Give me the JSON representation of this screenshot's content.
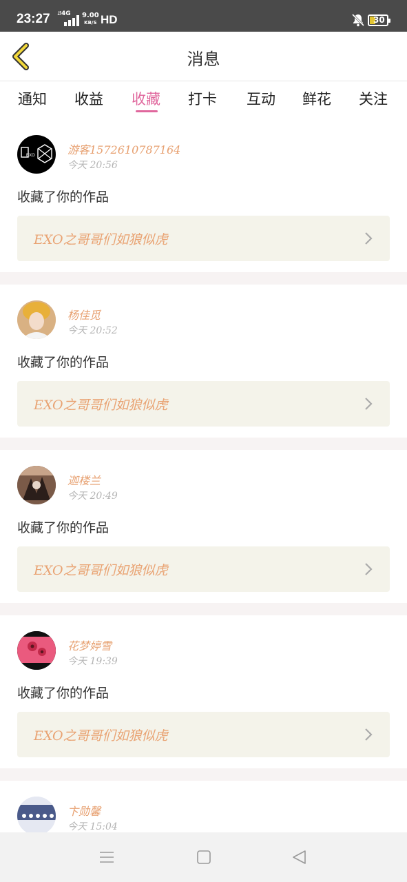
{
  "status_bar": {
    "time": "23:27",
    "network": "4G",
    "speed_value": "9.00",
    "speed_unit": "KB/S",
    "hd": "HD",
    "battery": "30",
    "icons": [
      "signal-icon",
      "bell-muted-icon",
      "battery-icon"
    ]
  },
  "header": {
    "title": "消息",
    "back_icon": "chevron-left-icon",
    "accent": "#f2d83a"
  },
  "tabs": [
    {
      "label": "通知",
      "active": false
    },
    {
      "label": "收益",
      "active": false
    },
    {
      "label": "收藏",
      "active": true
    },
    {
      "label": "打卡",
      "active": false
    },
    {
      "label": "互动",
      "active": false
    },
    {
      "label": "鲜花",
      "active": false
    },
    {
      "label": "关注",
      "active": false
    }
  ],
  "colors": {
    "active_tab": "#e0679d",
    "username": "#e7a070",
    "work_title": "#e9a373",
    "work_bg": "#f4f3ea"
  },
  "feed": [
    {
      "username": "游客1572610787164",
      "time": "今天 20:56",
      "action": "收藏了你的作品",
      "work_title": "EXO之哥哥们如狼似虎"
    },
    {
      "username": "杨佳觅",
      "time": "今天 20:52",
      "action": "收藏了你的作品",
      "work_title": "EXO之哥哥们如狼似虎"
    },
    {
      "username": "迦楼兰",
      "time": "今天 20:49",
      "action": "收藏了你的作品",
      "work_title": "EXO之哥哥们如狼似虎"
    },
    {
      "username": "花梦婷雪",
      "time": "今天 19:39",
      "action": "收藏了你的作品",
      "work_title": "EXO之哥哥们如狼似虎"
    },
    {
      "username": "卞勋馨",
      "time": "今天 15:04"
    }
  ],
  "nav": [
    "menu-icon",
    "home-square-icon",
    "back-triangle-icon"
  ]
}
